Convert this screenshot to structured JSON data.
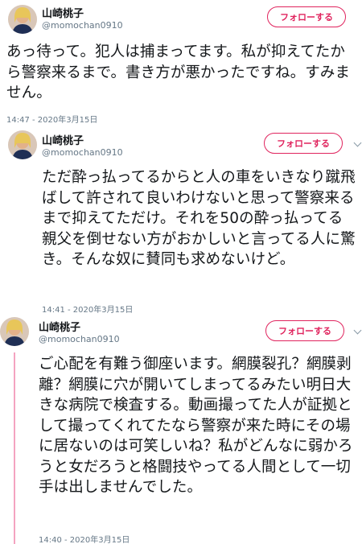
{
  "tweets": [
    {
      "name": "山崎桃子",
      "handle": "@momochan0910",
      "follow_label": "フォローする",
      "text": "あっ待って。犯人は捕まってます。私が抑えてたから警察来るまで。書き方が悪かったですね。すみません。",
      "timestamp": "14:47 - 2020年3月15日"
    },
    {
      "name": "山崎桃子",
      "handle": "@momochan0910",
      "follow_label": "フォローする",
      "text": "ただ酔っ払ってるからと人の車をいきなり蹴飛ばして許されて良いわけないと思って警察来るまで抑えてただけ。それを50の酔っ払ってる親父を倒せない方がおかしいと言ってる人に驚き。そんな奴に賛同も求めないけど。",
      "timestamp": "14:41 - 2020年3月15日"
    },
    {
      "name": "山崎桃子",
      "handle": "@momochan0910",
      "follow_label": "フォローする",
      "text": "ご心配を有難う御座います。網膜裂孔？網膜剥離？網膜に穴が開いてしまってるみたい明日大きな病院で検査する。動画撮ってた人が証拠として撮ってくれてたなら警察が来た時にその場に居ないのは可笑しいね？私がどんなに弱かろうと女だろうと格闘技やってる人間として一切手は出しませんでした。",
      "timestamp": "14:40 - 2020年3月15日"
    }
  ],
  "colors": {
    "follow_accent": "#e0245e",
    "thread_line": "#f4a3c0",
    "secondary_text": "#657786"
  }
}
